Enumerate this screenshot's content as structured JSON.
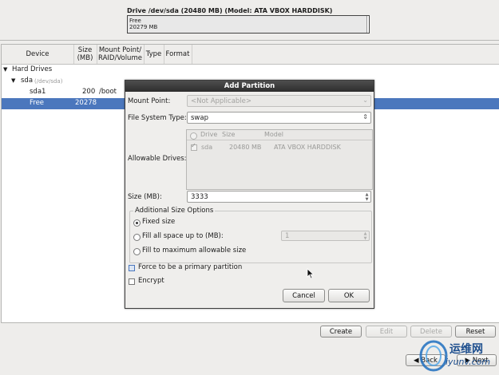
{
  "drive": {
    "title": "Drive /dev/sda (20480 MB) (Model: ATA VBOX HARDDISK)",
    "free_label": "Free",
    "free_size": "20279 MB"
  },
  "table": {
    "headers": [
      "Device",
      "Size\n(MB)",
      "Mount Point/\nRAID/Volume",
      "Type",
      "Format"
    ],
    "header_device": "Device",
    "header_size": "Size (MB)",
    "header_mount": "Mount Point/ RAID/Volume",
    "header_type": "Type",
    "header_format": "Format",
    "rows": [
      {
        "device": "Hard Drives"
      },
      {
        "device": "sda",
        "sub": "(/dev/sda)"
      },
      {
        "device": "sda1",
        "size": "200",
        "mount": "/boot"
      },
      {
        "device": "Free",
        "size": "20278"
      }
    ]
  },
  "dialog": {
    "title": "Add Partition",
    "mount_point_label": "Mount Point:",
    "mount_point_value": "<Not Applicable>",
    "fs_type_label": "File System Type:",
    "fs_type_value": "swap",
    "allowable_drives_label": "Allowable Drives:",
    "drives_headers": {
      "drive": "Drive",
      "size": "Size",
      "model": "Model"
    },
    "drives": [
      {
        "drive": "sda",
        "size": "20480 MB",
        "model": "ATA VBOX HARDDISK",
        "checked": true
      }
    ],
    "size_label": "Size (MB):",
    "size_value": "3333",
    "size_options_title": "Additional Size Options",
    "opt_fixed": "Fixed size",
    "opt_fill_up_to": "Fill all space up to (MB):",
    "fill_up_to_value": "1",
    "opt_fill_max": "Fill to maximum allowable size",
    "selected_option": "Fixed size",
    "force_primary": "Force to be a primary partition",
    "encrypt": "Encrypt",
    "cancel": "Cancel",
    "ok": "OK"
  },
  "buttons": {
    "create": "Create",
    "edit": "Edit",
    "delete": "Delete",
    "reset": "Reset",
    "back": "Back",
    "next": "Next"
  },
  "watermark": {
    "line1": "运维网",
    "line2": "iyunv.com"
  },
  "colors": {
    "selection": "#4b77bd",
    "dialog_title_bg": "#3a3a3a"
  }
}
